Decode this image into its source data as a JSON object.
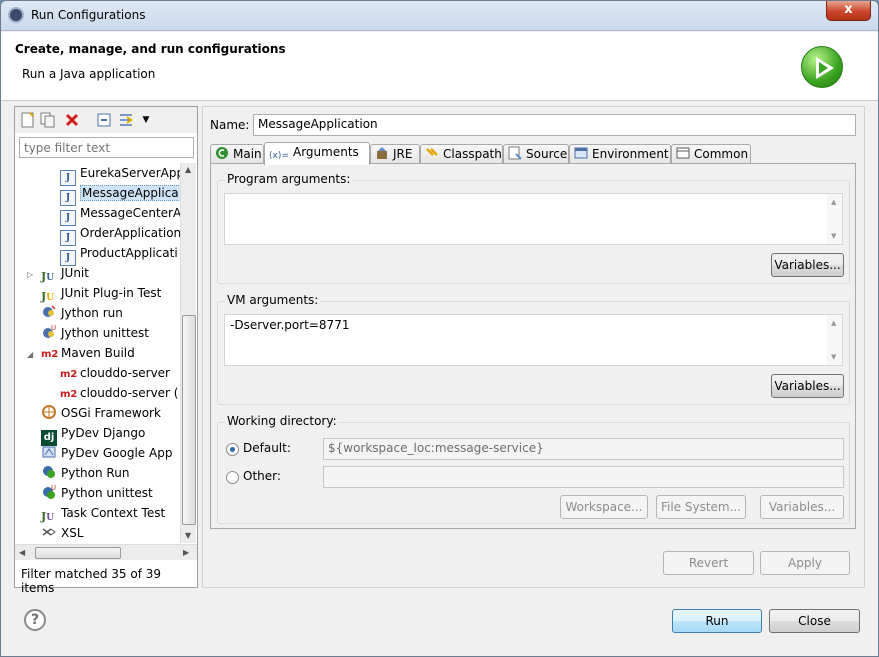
{
  "window": {
    "title": "Run Configurations",
    "close_glyph": "x"
  },
  "header": {
    "title": "Create, manage, and run configurations",
    "subtitle": "Run a Java application",
    "icon": "run-large-icon"
  },
  "left": {
    "filter_placeholder": "type filter text",
    "tree": [
      {
        "label": "EurekaServerApp",
        "icon": "java-app-icon",
        "indent": 2,
        "selected": false
      },
      {
        "label": "MessageApplica",
        "icon": "java-app-icon",
        "indent": 2,
        "selected": true
      },
      {
        "label": "MessageCenterA",
        "icon": "java-app-icon",
        "indent": 2,
        "selected": false
      },
      {
        "label": "OrderApplication",
        "icon": "java-app-icon",
        "indent": 2,
        "selected": false
      },
      {
        "label": "ProductApplicati",
        "icon": "java-app-icon",
        "indent": 2,
        "selected": false
      },
      {
        "label": "JUnit",
        "icon": "junit-icon",
        "indent": 1,
        "expander": "collapsed"
      },
      {
        "label": "JUnit Plug-in Test",
        "icon": "junit-plugin-icon",
        "indent": 1
      },
      {
        "label": "Jython run",
        "icon": "jython-icon",
        "indent": 1
      },
      {
        "label": "Jython unittest",
        "icon": "jython-unittest-icon",
        "indent": 1
      },
      {
        "label": "Maven Build",
        "icon": "maven-icon",
        "indent": 1,
        "expander": "expanded"
      },
      {
        "label": "clouddo-server",
        "icon": "maven-icon",
        "indent": 2
      },
      {
        "label": "clouddo-server (",
        "icon": "maven-icon",
        "indent": 2
      },
      {
        "label": "OSGi Framework",
        "icon": "osgi-icon",
        "indent": 1
      },
      {
        "label": "PyDev Django",
        "icon": "django-icon",
        "indent": 1
      },
      {
        "label": "PyDev Google App",
        "icon": "google-app-icon",
        "indent": 1
      },
      {
        "label": "Python Run",
        "icon": "python-icon",
        "indent": 1
      },
      {
        "label": "Python unittest",
        "icon": "python-unittest-icon",
        "indent": 1
      },
      {
        "label": "Task Context Test",
        "icon": "task-context-icon",
        "indent": 1
      },
      {
        "label": "XSL",
        "icon": "xsl-icon",
        "indent": 1
      }
    ],
    "filter_status": "Filter matched 35 of 39 items"
  },
  "config": {
    "name_label": "Name:",
    "name_value": "MessageApplication",
    "tabs": [
      {
        "label": "Main",
        "icon": "main-tab-icon",
        "active": false
      },
      {
        "label": "Arguments",
        "icon": "arguments-tab-icon",
        "active": true
      },
      {
        "label": "JRE",
        "icon": "jre-tab-icon",
        "active": false
      },
      {
        "label": "Classpath",
        "icon": "classpath-tab-icon",
        "active": false
      },
      {
        "label": "Source",
        "icon": "source-tab-icon",
        "active": false
      },
      {
        "label": "Environment",
        "icon": "environment-tab-icon",
        "active": false
      },
      {
        "label": "Common",
        "icon": "common-tab-icon",
        "active": false
      }
    ],
    "program_args": {
      "label": "Program arguments:",
      "value": "",
      "variables_btn": "Variables..."
    },
    "vm_args": {
      "label": "VM arguments:",
      "value": "-Dserver.port=8771",
      "variables_btn": "Variables..."
    },
    "working_dir": {
      "label": "Working directory:",
      "default_label": "Default:",
      "default_value": "${workspace_loc:message-service}",
      "other_label": "Other:",
      "other_value": "",
      "workspace_btn": "Workspace...",
      "filesystem_btn": "File System...",
      "variables_btn": "Variables..."
    },
    "revert_btn": "Revert",
    "apply_btn": "Apply"
  },
  "footer": {
    "help_glyph": "?",
    "run_btn": "Run",
    "close_btn": "Close"
  }
}
